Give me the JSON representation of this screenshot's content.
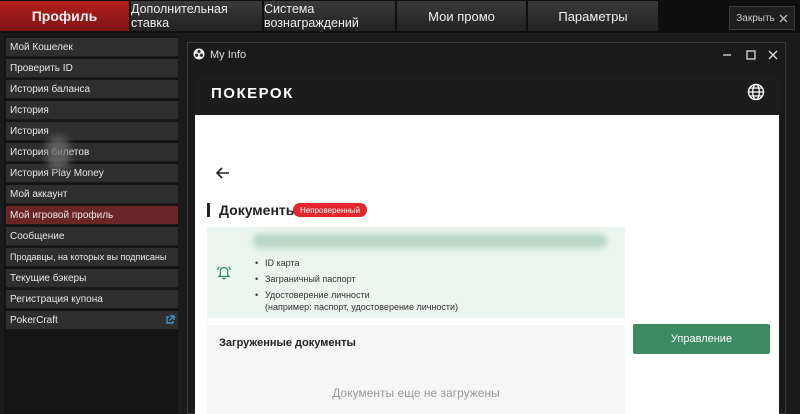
{
  "tabs": [
    {
      "label": "Профиль",
      "active": true
    },
    {
      "label": "Дополнительная ставка"
    },
    {
      "label": "Система вознаграждений"
    },
    {
      "label": "Мои промо"
    },
    {
      "label": "Параметры"
    }
  ],
  "close_label": "Закрыть",
  "sidebar": {
    "items": [
      {
        "label": "Мой Кошелек"
      },
      {
        "label": "Проверить ID"
      },
      {
        "label": "История баланса"
      },
      {
        "label": "История"
      },
      {
        "label": "История"
      },
      {
        "label": "История билетов"
      },
      {
        "label": "История Play Money"
      },
      {
        "label": "Мой аккаунт"
      },
      {
        "label": "Мой игровой профиль",
        "active": true
      },
      {
        "label": "Сообщение"
      },
      {
        "label": "Продавцы, на которых вы подписаны"
      },
      {
        "label": "Текущие бэкеры"
      },
      {
        "label": "Регистрация купона"
      },
      {
        "label": "PokerCraft",
        "external": true
      }
    ]
  },
  "window": {
    "title": "My Info",
    "brand": "ПОКЕРОК",
    "section_title": "Документы",
    "status_badge": "Непроверенный",
    "requirements": [
      "ID карта",
      "Заграничный паспорт",
      "Удостоверение личности",
      "(например: паспорт, удостоверение личности)"
    ],
    "uploaded_title": "Загруженные документы",
    "uploaded_empty": "Документы еще не загружены",
    "manage_button": "Управление"
  },
  "colors": {
    "active_tab": "#a01c1a",
    "active_sidebar": "#6a2626",
    "badge": "#e3262c",
    "manage_button": "#3e8a63",
    "notice_bg": "#e9f5ee"
  },
  "icons": [
    "close-x-icon",
    "external-link-icon",
    "window-app-icon",
    "minimize-icon",
    "maximize-icon",
    "close-window-icon",
    "globe-icon",
    "back-arrow-icon",
    "bell-icon"
  ]
}
